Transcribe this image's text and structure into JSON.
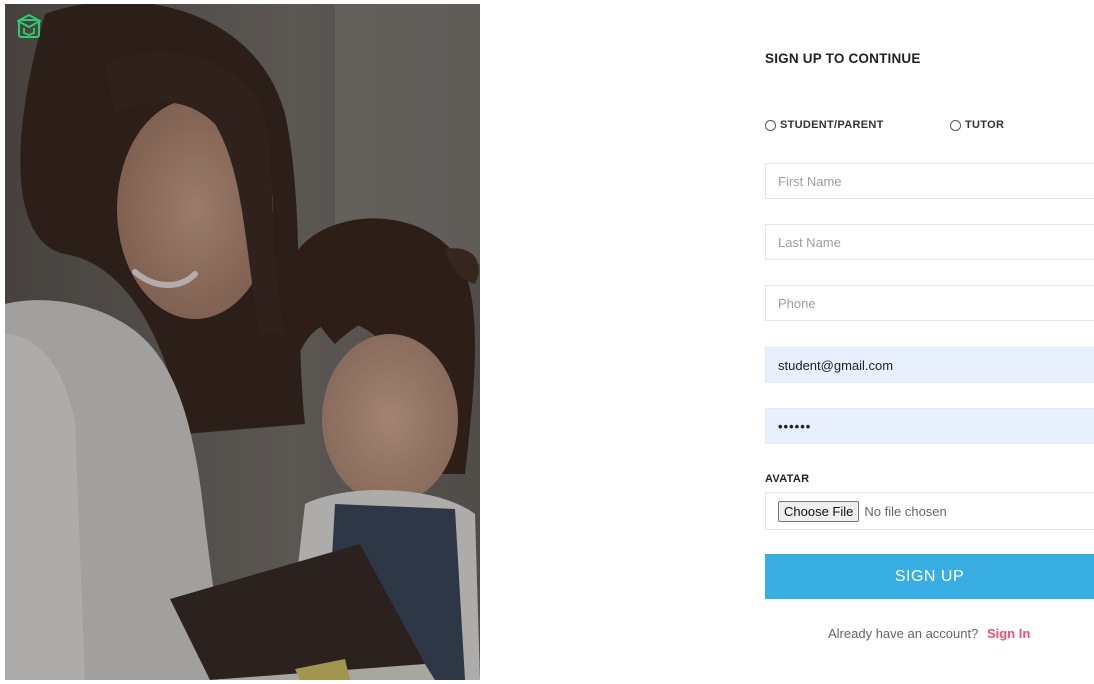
{
  "logo": {
    "icon": "graduation-cap-icon",
    "color": "#2ecc71"
  },
  "form": {
    "title": "SIGN UP TO CONTINUE",
    "roles": [
      {
        "label": "STUDENT/PARENT",
        "selected": false
      },
      {
        "label": "TUTOR",
        "selected": false
      }
    ],
    "fields": {
      "first_name": {
        "placeholder": "First Name",
        "value": ""
      },
      "last_name": {
        "placeholder": "Last Name",
        "value": ""
      },
      "phone": {
        "placeholder": "Phone",
        "value": ""
      },
      "email": {
        "value": "student@gmail.com"
      },
      "password": {
        "value": "••••••"
      }
    },
    "avatar": {
      "label": "AVATAR",
      "button_label": "Choose File",
      "status": "No file chosen"
    },
    "submit_label": "SIGN UP",
    "signin_prompt": "Already have an account?",
    "signin_link": "Sign In"
  },
  "colors": {
    "primary": "#38aee3",
    "link": "#f0506e",
    "autofill_bg": "#e8f0fe",
    "logo": "#2ecc71"
  }
}
